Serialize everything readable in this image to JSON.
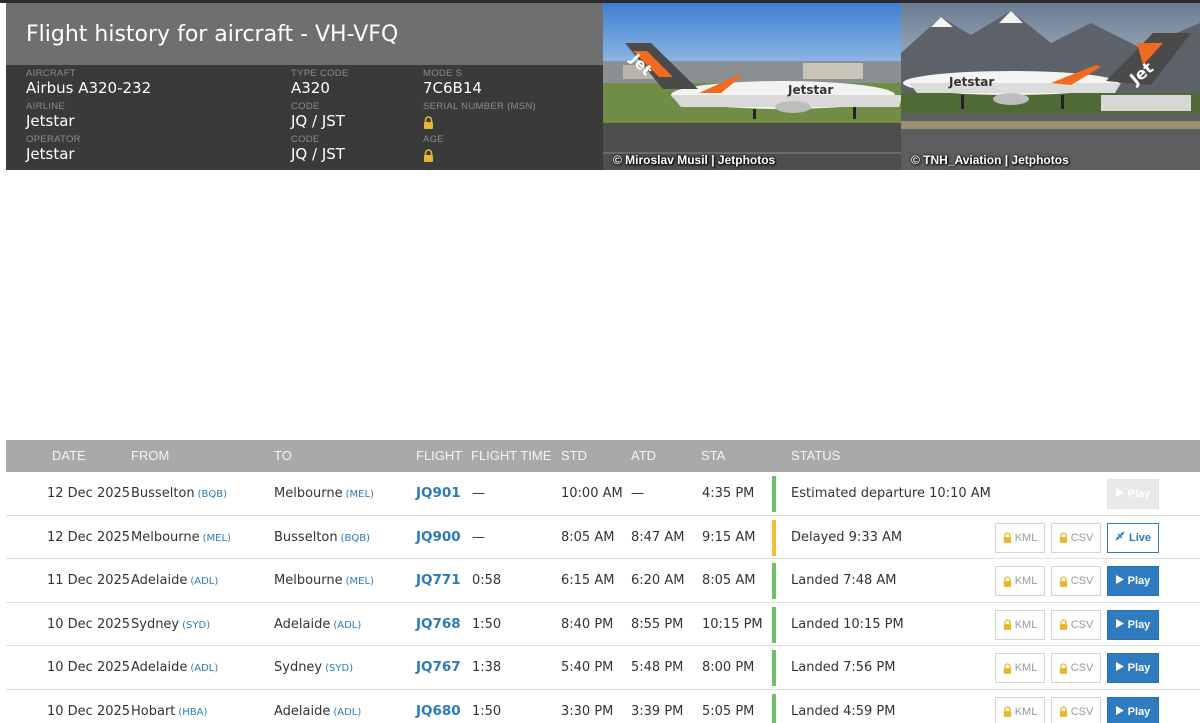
{
  "header": {
    "title": "Flight history for aircraft - VH-VFQ",
    "fields": [
      {
        "label": "AIRCRAFT",
        "value": "Airbus A320-232"
      },
      {
        "label": "AIRLINE",
        "value": "Jetstar"
      },
      {
        "label": "OPERATOR",
        "value": "Jetstar"
      },
      {
        "label": "TYPE CODE",
        "value": "A320"
      },
      {
        "label": "Code",
        "value": "JQ / JST"
      },
      {
        "label": "Code",
        "value": "JQ / JST"
      },
      {
        "label": "MODE S",
        "value": "7C6B14"
      },
      {
        "label": "SERIAL NUMBER (MSN)",
        "value": "lock-icon"
      },
      {
        "label": "AGE",
        "value": "lock-icon"
      }
    ]
  },
  "photos": [
    {
      "credit": "© Miroslav Musil | Jetphotos",
      "livery_text": "Jetstar",
      "tail_text": "Jet"
    },
    {
      "credit": "© TNH_Aviation | Jetphotos",
      "livery_text": "Jetstar",
      "tail_text": "Jet"
    }
  ],
  "table": {
    "headers": [
      "DATE",
      "FROM",
      "TO",
      "FLIGHT",
      "FLIGHT TIME",
      "STD",
      "ATD",
      "STA",
      "STATUS"
    ],
    "kml_label": "KML",
    "csv_label": "CSV",
    "rows": [
      {
        "date": "12 Dec 2025",
        "from": "Busselton",
        "from_code": "(BQB)",
        "to": "Melbourne",
        "to_code": "(MEL)",
        "flight": "JQ901",
        "flight_time": "—",
        "std": "10:00 AM",
        "atd": "—",
        "sta": "4:35 PM",
        "status": "Estimated departure 10:10 AM",
        "status_color": "#6cc267",
        "action": "Play",
        "action_state": "disabled",
        "show_files": false
      },
      {
        "date": "12 Dec 2025",
        "from": "Melbourne",
        "from_code": "(MEL)",
        "to": "Busselton",
        "to_code": "(BQB)",
        "flight": "JQ900",
        "flight_time": "—",
        "std": "8:05 AM",
        "atd": "8:47 AM",
        "sta": "9:15 AM",
        "status": "Delayed 9:33 AM",
        "status_color": "#f0c232",
        "action": "Live",
        "action_state": "live",
        "show_files": true
      },
      {
        "date": "11 Dec 2025",
        "from": "Adelaide",
        "from_code": "(ADL)",
        "to": "Melbourne",
        "to_code": "(MEL)",
        "flight": "JQ771",
        "flight_time": "0:58",
        "std": "6:15 AM",
        "atd": "6:20 AM",
        "sta": "8:05 AM",
        "status": "Landed 7:48 AM",
        "status_color": "#6cc267",
        "action": "Play",
        "action_state": "play",
        "show_files": true
      },
      {
        "date": "10 Dec 2025",
        "from": "Sydney",
        "from_code": "(SYD)",
        "to": "Adelaide",
        "to_code": "(ADL)",
        "flight": "JQ768",
        "flight_time": "1:50",
        "std": "8:40 PM",
        "atd": "8:55 PM",
        "sta": "10:15 PM",
        "status": "Landed 10:15 PM",
        "status_color": "#6cc267",
        "action": "Play",
        "action_state": "play",
        "show_files": true
      },
      {
        "date": "10 Dec 2025",
        "from": "Adelaide",
        "from_code": "(ADL)",
        "to": "Sydney",
        "to_code": "(SYD)",
        "flight": "JQ767",
        "flight_time": "1:38",
        "std": "5:40 PM",
        "atd": "5:48 PM",
        "sta": "8:00 PM",
        "status": "Landed 7:56 PM",
        "status_color": "#6cc267",
        "action": "Play",
        "action_state": "play",
        "show_files": true
      },
      {
        "date": "10 Dec 2025",
        "from": "Hobart",
        "from_code": "(HBA)",
        "to": "Adelaide",
        "to_code": "(ADL)",
        "flight": "JQ680",
        "flight_time": "1:50",
        "std": "3:30 PM",
        "atd": "3:39 PM",
        "sta": "5:05 PM",
        "status": "Landed 4:59 PM",
        "status_color": "#6cc267",
        "action": "Play",
        "action_state": "play",
        "show_files": true
      }
    ]
  },
  "colors": {
    "accent": "#2f7bbf",
    "landed": "#6cc267",
    "delayed": "#f0c232",
    "lock": "#e8b62a"
  }
}
